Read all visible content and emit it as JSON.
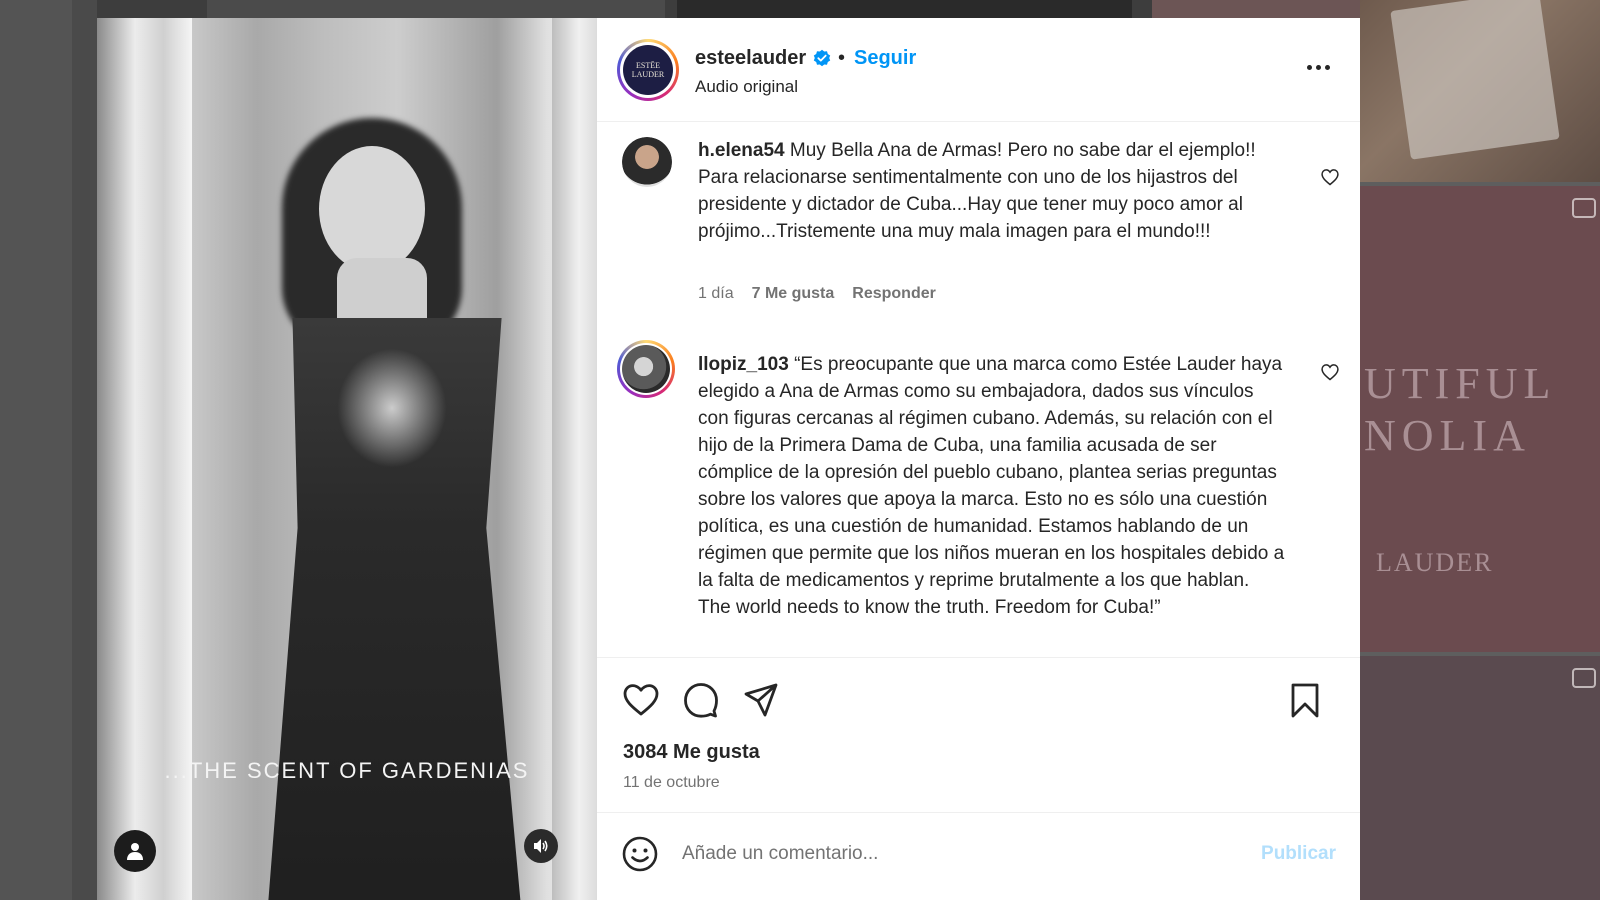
{
  "post": {
    "handle": "esteelauder",
    "follow_label": "Seguir",
    "separator": "•",
    "audio": "Audio original",
    "logo_line1": "ESTĒE",
    "logo_line2": "LAUDER",
    "media_caption": "...THE SCENT OF GARDENIAS",
    "likes": "3084 Me gusta",
    "date": "11 de octubre"
  },
  "comments": [
    {
      "user": "h.elena54",
      "text": "Muy Bella Ana de Armas! Pero no sabe dar el ejemplo!! Para relacionarse sentimentalmente con uno de los hijastros del presidente y dictador de Cuba...Hay que tener muy poco amor al prójimo...Tristemente una muy mala imagen para el mundo!!!",
      "age": "1 día",
      "likes": "7 Me gusta",
      "reply": "Responder"
    },
    {
      "user": "llopiz_103",
      "text": "“Es preocupante que una marca como Estée Lauder haya elegido a Ana de Armas como su embajadora, dados sus vínculos con figuras cercanas al régimen cubano. Además, su relación con el hijo de la Primera Dama de Cuba, una familia acusada de ser cómplice de la opresión del pueblo cubano, plantea serias preguntas sobre los valores que apoya la marca. Esto no es sólo una cuestión política, es una cuestión de humanidad. Estamos hablando de un régimen que permite que los niños mueran en los hospitales debido a la falta de medicamentos y reprime brutalmente a los que hablan.",
      "text2": "The world needs to know the truth. Freedom for Cuba!”"
    }
  ],
  "composer": {
    "placeholder": "Añade un comentario...",
    "publish_label": "Publicar"
  },
  "background": {
    "word1": "UTIFUL",
    "word2": "NOLIA",
    "word3": "LAUDER"
  },
  "colors": {
    "link_blue": "#0095f6",
    "publish_disabled": "#b2dffc",
    "text": "#262626",
    "muted": "#737373"
  },
  "icons": [
    "verified-badge-icon",
    "more-options-icon",
    "heart-icon",
    "comment-icon",
    "share-icon",
    "bookmark-icon",
    "emoji-icon",
    "user-tag-icon",
    "volume-icon"
  ]
}
